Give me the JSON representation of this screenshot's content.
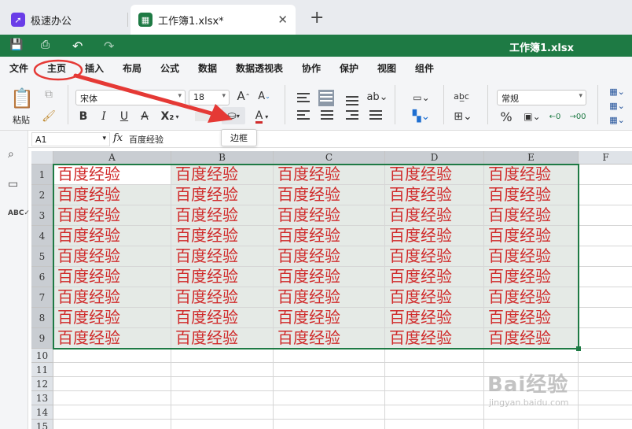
{
  "tabs": [
    {
      "label": "极速办公"
    },
    {
      "label": "工作簿1.xlsx*"
    }
  ],
  "window_title": "工作簿1.xlsx",
  "menu": [
    "文件",
    "主页",
    "插入",
    "布局",
    "公式",
    "数据",
    "数据透视表",
    "协作",
    "保护",
    "视图",
    "组件"
  ],
  "active_menu": "主页",
  "ribbon": {
    "paste_label": "粘贴",
    "font_name": "宋体",
    "font_size": "18",
    "number_format": "常规",
    "bold": "B",
    "italic": "I",
    "underline": "U",
    "strike": "A",
    "subscript": "X₂",
    "font_color": "A",
    "percent": "%",
    "grow_font": "A",
    "shrink_font": "A"
  },
  "tooltip": "边框",
  "formula_bar": {
    "cell_ref": "A1",
    "fx": "fx",
    "content": "百度经验"
  },
  "sheet": {
    "columns": [
      "A",
      "B",
      "C",
      "D",
      "E",
      "F"
    ],
    "rows": [
      "1",
      "2",
      "3",
      "4",
      "5",
      "6",
      "7",
      "8",
      "9",
      "10",
      "11",
      "12",
      "13",
      "14",
      "15"
    ],
    "cells": [
      [
        "百度经验",
        "百度经验",
        "百度经验",
        "百度经验",
        "百度经验"
      ],
      [
        "百度经验",
        "百度经验",
        "百度经验",
        "百度经验",
        "百度经验"
      ],
      [
        "百度经验",
        "百度经验",
        "百度经验",
        "百度经验",
        "百度经验"
      ],
      [
        "百度经验",
        "百度经验",
        "百度经验",
        "百度经验",
        "百度经验"
      ],
      [
        "百度经验",
        "百度经验",
        "百度经验",
        "百度经验",
        "百度经验"
      ],
      [
        "百度经验",
        "百度经验",
        "百度经验",
        "百度经验",
        "百度经验"
      ],
      [
        "百度经验",
        "百度经验",
        "百度经验",
        "百度经验",
        "百度经验"
      ],
      [
        "百度经验",
        "百度经验",
        "百度经验",
        "百度经验",
        "百度经验"
      ],
      [
        "百度经验",
        "百度经验",
        "百度经验",
        "百度经验",
        "百度经验"
      ]
    ],
    "text_color": "#d02b2b",
    "selection_color": "#1e7a44"
  },
  "colors": {
    "brand_green": "#1e7a44",
    "annotation_red": "#e53935"
  },
  "watermark": {
    "brand": "Bai经验",
    "url": "jingyan.baidu.com"
  }
}
